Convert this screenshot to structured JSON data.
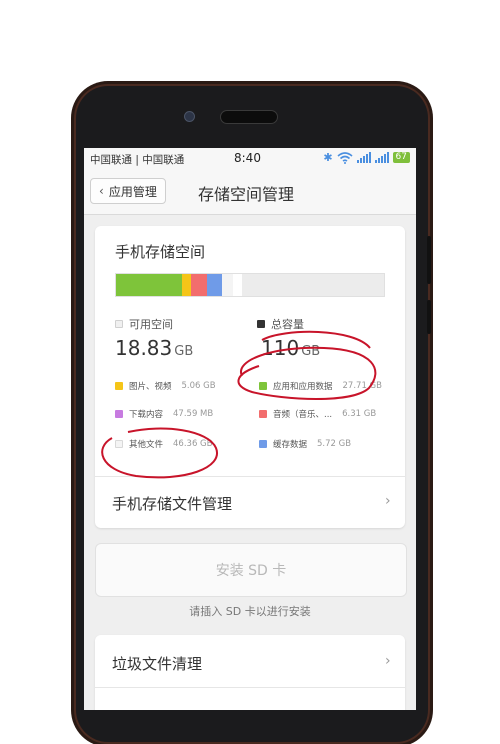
{
  "status_bar": {
    "carrier": "中国联通 | 中国联通",
    "time": "8:40",
    "battery": "67"
  },
  "header": {
    "back_label": "应用管理",
    "title": "存储空间管理"
  },
  "storage_card": {
    "title": "手机存储空间",
    "available": {
      "label": "可用空间",
      "value": "18.83",
      "unit": "GB",
      "color": "#e8e8e8"
    },
    "total": {
      "label": "总容量",
      "value": "110",
      "unit": "GB",
      "color": "#333333"
    },
    "usage_segments": [
      {
        "fraction": 0.245,
        "color": "#7ec43a"
      },
      {
        "fraction": 0.035,
        "color": "#f5c518"
      },
      {
        "fraction": 0.06,
        "color": "#f26d6d"
      },
      {
        "fraction": 0.055,
        "color": "#6f9be8"
      },
      {
        "fraction": 0.04,
        "color": "#f4f4f4"
      },
      {
        "fraction": 0.035,
        "color": "#ffffff"
      },
      {
        "fraction": 0.17,
        "color": "#ececec"
      }
    ],
    "legend": [
      {
        "label": "图片、视频",
        "value": "5.06 GB",
        "color": "#f5c518"
      },
      {
        "label": "应用和应用数据",
        "value": "27.71 GB",
        "color": "#7ec43a"
      },
      {
        "label": "下载内容",
        "value": "47.59 MB",
        "color": "#c77be0"
      },
      {
        "label": "音频（音乐、...",
        "value": "6.31 GB",
        "color": "#f26d6d"
      },
      {
        "label": "其他文件",
        "value": "46.36 GB",
        "color": "#eeeeee"
      },
      {
        "label": "缓存数据",
        "value": "5.72 GB",
        "color": "#6f9be8"
      }
    ],
    "file_manager_label": "手机存储文件管理"
  },
  "sd": {
    "button_label": "安装 SD 卡",
    "hint": "请插入 SD 卡以进行安装"
  },
  "tools": {
    "junk_clean_label": "垃圾文件清理"
  }
}
